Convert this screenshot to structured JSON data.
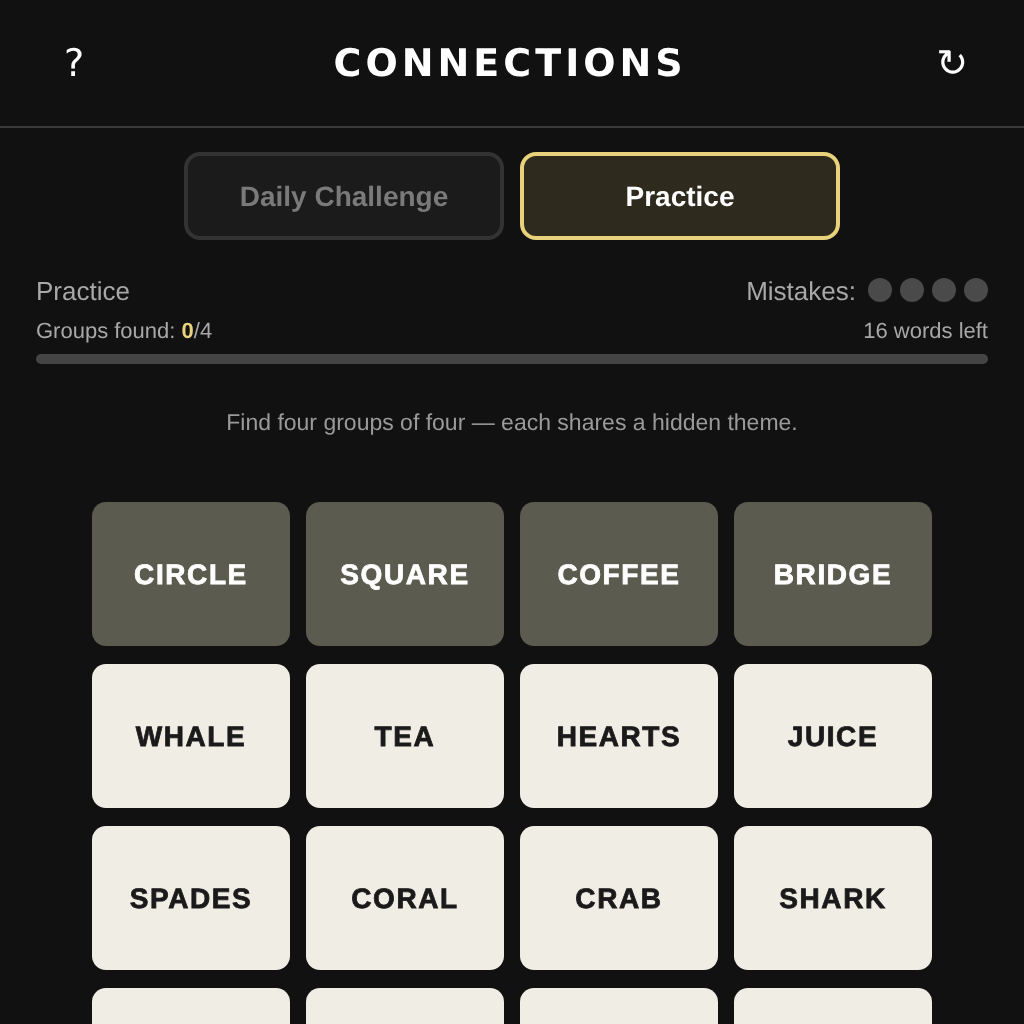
{
  "header": {
    "help": "?",
    "title": "CONNECTIONS",
    "refresh": "↻"
  },
  "tabs": [
    {
      "label": "Daily Challenge",
      "selected": false
    },
    {
      "label": "Practice",
      "selected": true
    }
  ],
  "status": {
    "mode": "Practice",
    "mistakes_label": "Mistakes:",
    "mistakes": [
      {
        "used": false
      },
      {
        "used": false
      },
      {
        "used": false
      },
      {
        "used": false
      }
    ],
    "groups_label": "Groups found: ",
    "groups_found": "0",
    "groups_total": "/4",
    "words_left": "16 words left",
    "level": 0
  },
  "hint": "Find four groups of four — each shares a hidden theme.",
  "tiles": [
    {
      "word": "CIRCLE",
      "selected": true
    },
    {
      "word": "SQUARE",
      "selected": true
    },
    {
      "word": "COFFEE",
      "selected": true
    },
    {
      "word": "BRIDGE",
      "selected": true
    },
    {
      "word": "WHALE",
      "selected": false
    },
    {
      "word": "TEA",
      "selected": false
    },
    {
      "word": "HEARTS",
      "selected": false
    },
    {
      "word": "JUICE",
      "selected": false
    },
    {
      "word": "SPADES",
      "selected": false
    },
    {
      "word": "CORAL",
      "selected": false
    },
    {
      "word": "CRAB",
      "selected": false
    },
    {
      "word": "SHARK",
      "selected": false
    },
    {
      "selected": false
    },
    {
      "selected": false
    },
    {
      "selected": false
    },
    {
      "selected": false
    }
  ]
}
